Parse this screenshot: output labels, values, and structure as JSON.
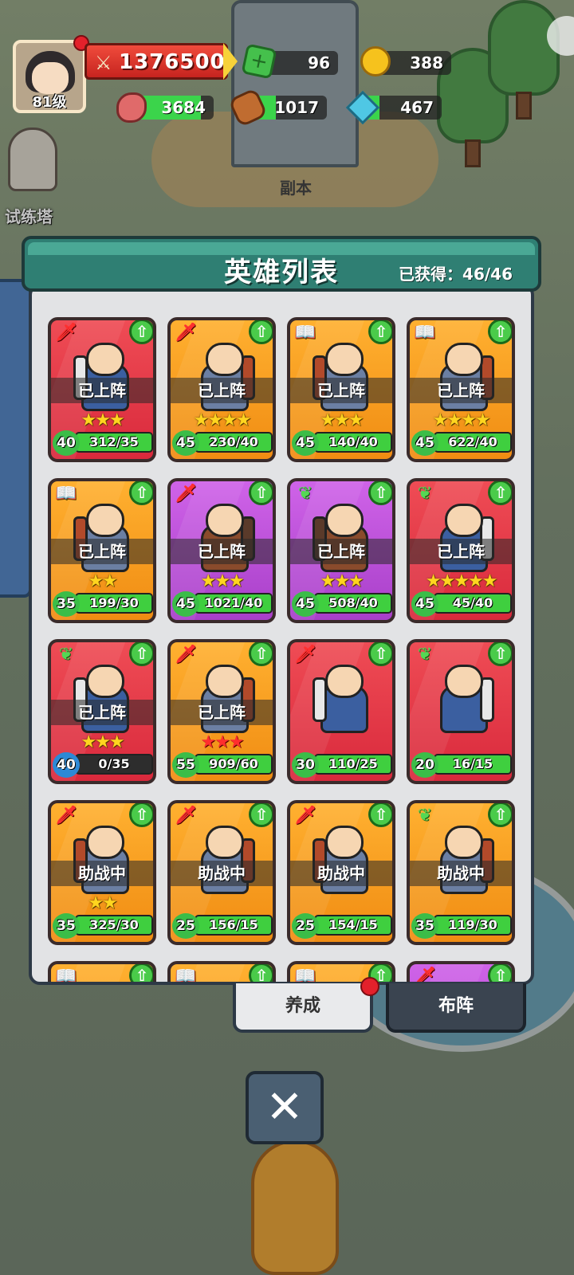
{
  "hud": {
    "avatar_level": "81级",
    "power": "1376500",
    "gems": "96",
    "gold": "388",
    "meat": "3684",
    "wood": "1017",
    "crystal": "467"
  },
  "map": {
    "dungeon_label": "副本",
    "tower_label": "试练塔"
  },
  "panel": {
    "title": "英雄列表",
    "obtained": "已获得：46/46"
  },
  "heroes": [
    {
      "color": "red",
      "type": "dagger",
      "status": "已上阵",
      "stars": 3,
      "star_color": "gold",
      "level": "40",
      "level_color": "green",
      "progress": "312/35",
      "fill": 1.0
    },
    {
      "color": "orange",
      "type": "dagger",
      "status": "已上阵",
      "stars": 4,
      "star_color": "gold",
      "level": "45",
      "level_color": "green",
      "progress": "230/40",
      "fill": 1.0
    },
    {
      "color": "orange",
      "type": "book",
      "status": "已上阵",
      "stars": 3,
      "star_color": "gold",
      "level": "45",
      "level_color": "green",
      "progress": "140/40",
      "fill": 1.0
    },
    {
      "color": "orange",
      "type": "book",
      "status": "已上阵",
      "stars": 4,
      "star_color": "gold",
      "level": "45",
      "level_color": "green",
      "progress": "622/40",
      "fill": 1.0
    },
    {
      "color": "orange",
      "type": "book",
      "status": "已上阵",
      "stars": 2,
      "star_color": "gold",
      "level": "35",
      "level_color": "green",
      "progress": "199/30",
      "fill": 1.0
    },
    {
      "color": "purple",
      "type": "dagger",
      "status": "已上阵",
      "stars": 3,
      "star_color": "gold",
      "level": "45",
      "level_color": "green",
      "progress": "1021/40",
      "fill": 1.0
    },
    {
      "color": "purple",
      "type": "leaf",
      "status": "已上阵",
      "stars": 3,
      "star_color": "gold",
      "level": "45",
      "level_color": "green",
      "progress": "508/40",
      "fill": 1.0
    },
    {
      "color": "red",
      "type": "leaf",
      "status": "已上阵",
      "stars": 5,
      "star_color": "gold",
      "level": "45",
      "level_color": "green",
      "progress": "45/40",
      "fill": 1.0
    },
    {
      "color": "red",
      "type": "leaf",
      "status": "已上阵",
      "stars": 3,
      "star_color": "gold",
      "level": "40",
      "level_color": "blue",
      "progress": "0/35",
      "fill": 0.0
    },
    {
      "color": "orange",
      "type": "dagger",
      "status": "已上阵",
      "stars": 3,
      "star_color": "red",
      "level": "55",
      "level_color": "green",
      "progress": "909/60",
      "fill": 1.0
    },
    {
      "color": "red",
      "type": "dagger",
      "status": "",
      "stars": 0,
      "star_color": "gold",
      "level": "30",
      "level_color": "green",
      "progress": "110/25",
      "fill": 1.0
    },
    {
      "color": "red",
      "type": "leaf",
      "status": "",
      "stars": 0,
      "star_color": "gold",
      "level": "20",
      "level_color": "green",
      "progress": "16/15",
      "fill": 1.0
    },
    {
      "color": "orange",
      "type": "dagger",
      "status": "助战中",
      "stars": 2,
      "star_color": "gold",
      "level": "35",
      "level_color": "green",
      "progress": "325/30",
      "fill": 1.0
    },
    {
      "color": "orange",
      "type": "dagger",
      "status": "助战中",
      "stars": 0,
      "star_color": "gold",
      "level": "25",
      "level_color": "green",
      "progress": "156/15",
      "fill": 1.0
    },
    {
      "color": "orange",
      "type": "dagger",
      "status": "助战中",
      "stars": 0,
      "star_color": "gold",
      "level": "25",
      "level_color": "green",
      "progress": "154/15",
      "fill": 1.0
    },
    {
      "color": "orange",
      "type": "leaf",
      "status": "助战中",
      "stars": 0,
      "star_color": "gold",
      "level": "35",
      "level_color": "green",
      "progress": "119/30",
      "fill": 1.0
    },
    {
      "color": "orange",
      "type": "book",
      "status": "",
      "stars": 0,
      "star_color": "gold",
      "level": "",
      "level_color": "green",
      "progress": "",
      "fill": 0.0
    },
    {
      "color": "orange",
      "type": "book",
      "status": "",
      "stars": 0,
      "star_color": "gold",
      "level": "",
      "level_color": "green",
      "progress": "",
      "fill": 0.0
    },
    {
      "color": "orange",
      "type": "book",
      "status": "",
      "stars": 0,
      "star_color": "gold",
      "level": "",
      "level_color": "green",
      "progress": "",
      "fill": 0.0
    },
    {
      "color": "purple",
      "type": "dagger",
      "status": "",
      "stars": 0,
      "star_color": "gold",
      "level": "",
      "level_color": "green",
      "progress": "",
      "fill": 0.0
    }
  ],
  "tabs": {
    "train": "养成",
    "formation": "布阵"
  },
  "close_symbol": "✕",
  "icons": {
    "up": "⇧",
    "dagger": "🗡",
    "book": "📖",
    "leaf": "❦",
    "star": "★"
  },
  "colors": {
    "panel_header": "#2f7f73",
    "card_red": "#d9293c",
    "card_orange": "#f08c12",
    "card_purple": "#a83fc9",
    "progress_fill": "#3fcf3f"
  }
}
